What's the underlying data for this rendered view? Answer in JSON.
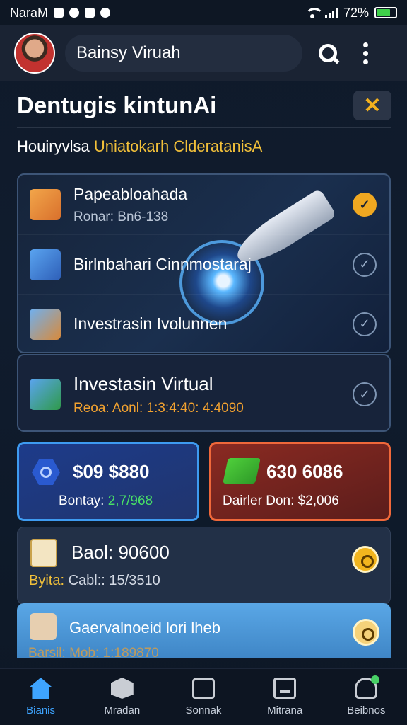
{
  "status_bar": {
    "carrier": "NaraM",
    "battery": "72%",
    "battery_level": 0.72
  },
  "header": {
    "search_text": "Bainsy Viruah"
  },
  "section": {
    "title": "Dentugis kintunAi",
    "subtitle_main": "Houiryvlsa",
    "subtitle_accent": "Uniatokarh Clderatanis",
    "subtitle_tail": "A"
  },
  "options": [
    {
      "title": "Papeabloahada",
      "sub": "Ronar: Bn6-138",
      "checked": true,
      "icon": "package-icon"
    },
    {
      "title": "Birlnbahari Cinnmostaraj",
      "sub": "",
      "checked": false,
      "icon": "building-icon"
    },
    {
      "title": "Investrasin Ivolunnen",
      "sub": "",
      "checked": false,
      "icon": "server-icon"
    }
  ],
  "featured_option": {
    "title": "Investasin Virtual",
    "sub": "Reoa: Aonl: 1:3:4:40: 4:4090",
    "checked": false,
    "icon": "plant-box-icon"
  },
  "stats": {
    "left": {
      "value": "$09 $880",
      "label": "Bontay:",
      "label_value": "2,7/968",
      "icon": "hexagon-icon"
    },
    "right": {
      "value": "630 6086",
      "label": "Dairler Don: $2,006",
      "icon": "cash-icon"
    }
  },
  "balance": {
    "title": "Baol: 90600",
    "sub_label": "Byita:",
    "sub_value": "Cabl:: 15/3510",
    "icon": "document-icon"
  },
  "highlight": {
    "title": "Gaervalnoeid lori lheb",
    "sub": "Barsil: Mob: 1:189870",
    "icon": "cargo-icon"
  },
  "nav": [
    {
      "label": "Bianis",
      "icon": "home-icon",
      "active": true
    },
    {
      "label": "Mradan",
      "icon": "box-icon",
      "active": false
    },
    {
      "label": "Sonnak",
      "icon": "bag-icon",
      "active": false
    },
    {
      "label": "Mitrana",
      "icon": "screen-icon",
      "active": false
    },
    {
      "label": "Beibnos",
      "icon": "user-icon",
      "active": false
    }
  ],
  "colors": {
    "accent": "#3ea4ff",
    "gold": "#f0a821",
    "green": "#48e066",
    "orange_text": "#f2a230",
    "background": "#101c2e"
  }
}
